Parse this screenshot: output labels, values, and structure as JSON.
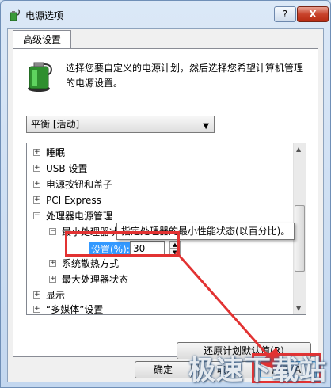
{
  "window": {
    "title": "电源选项",
    "help_label": "?",
    "close_label": "X"
  },
  "tab": {
    "label": "高级设置"
  },
  "description": "选择您要自定义的电源计划，然后选择您希望计算机管理的电源设置。",
  "plan_select": {
    "value": "平衡 [活动]"
  },
  "tree": {
    "items": [
      {
        "label": "睡眠",
        "expander": "+"
      },
      {
        "label": "USB 设置",
        "expander": "+"
      },
      {
        "label": "电源按钮和盖子",
        "expander": "+"
      },
      {
        "label": "PCI Express",
        "expander": "+"
      },
      {
        "label": "处理器电源管理",
        "expander": "−"
      },
      {
        "label": "最小处理器状态",
        "expander": "−"
      },
      {
        "label": "系统散热方式",
        "expander": "+"
      },
      {
        "label": "最大处理器状态",
        "expander": "+"
      },
      {
        "label": "显示",
        "expander": "+"
      },
      {
        "label": "“多媒体”设置",
        "expander": "+"
      }
    ],
    "setting": {
      "label": "设置(%):",
      "value": "30"
    }
  },
  "tooltip": "指定处理器的最小性能状态(以百分比)。",
  "buttons": {
    "restore": "还原计划默认值(R)",
    "ok": "确定",
    "cancel": "取消",
    "apply": "应用(A)"
  },
  "watermark": "极速下载站",
  "colors": {
    "highlight": "#e23232",
    "selection": "#3399ff"
  }
}
